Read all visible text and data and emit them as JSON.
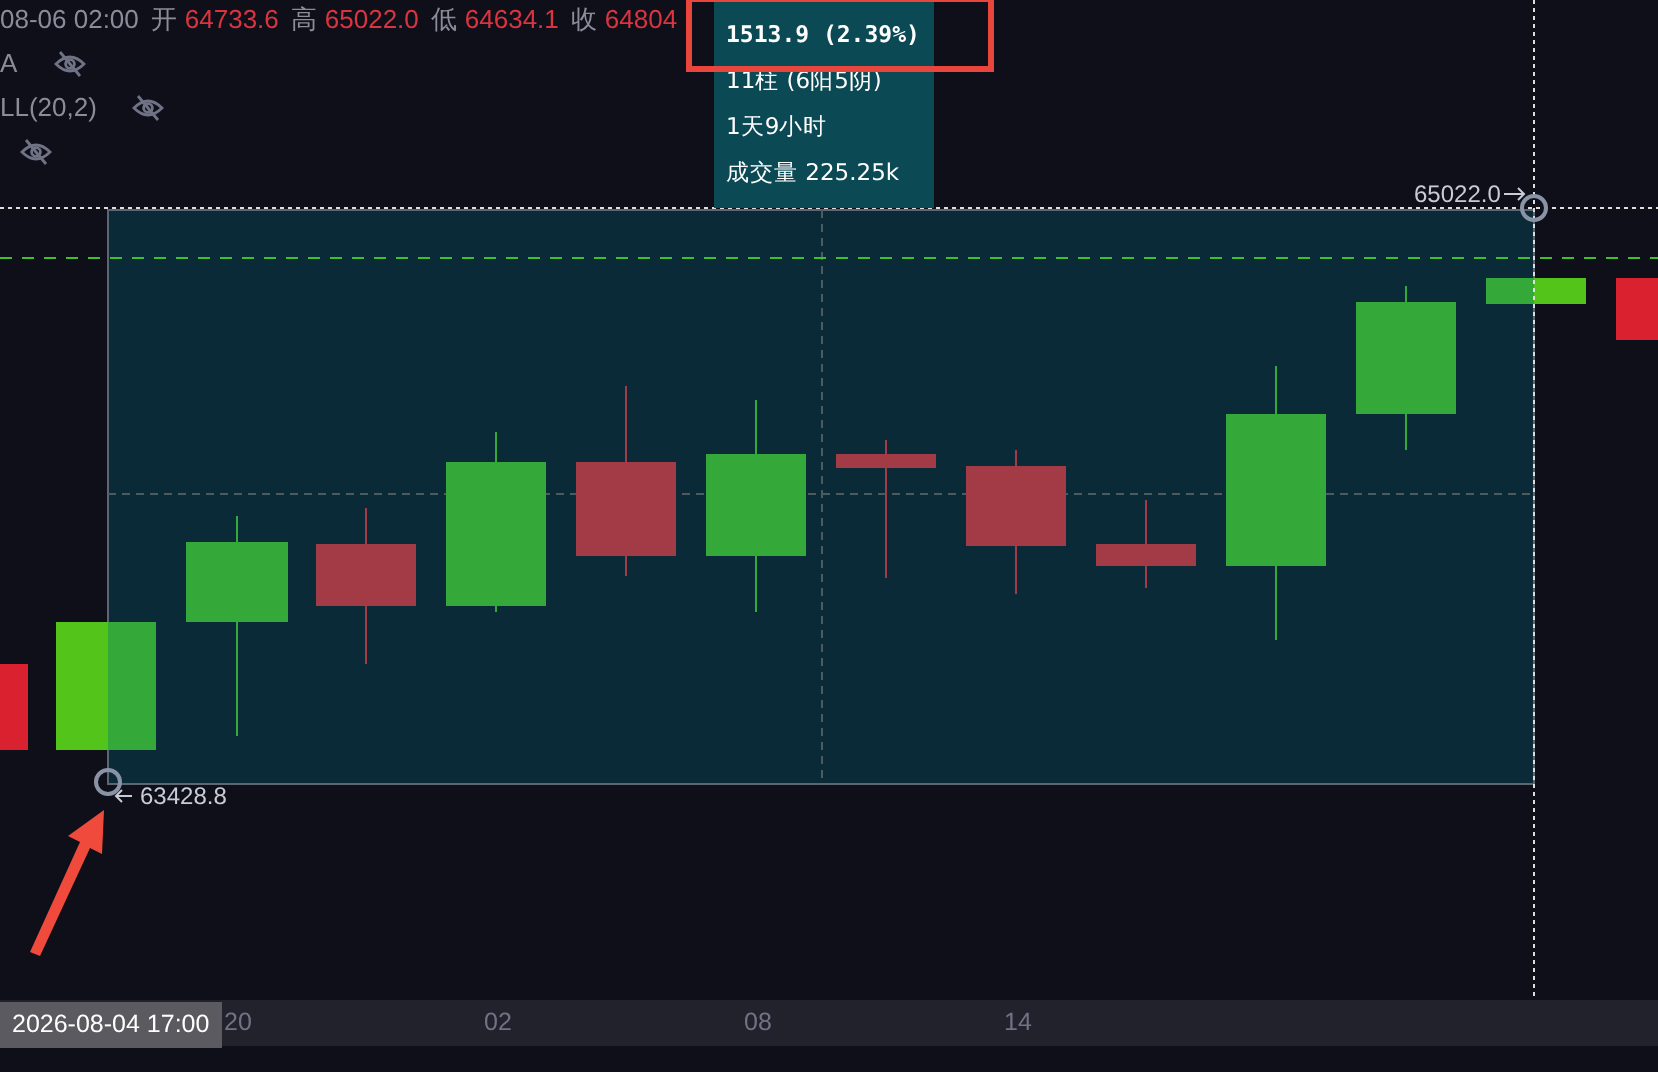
{
  "legend": {
    "time": "08-06 02:00",
    "fields": [
      {
        "label": "开",
        "value": "64733.6"
      },
      {
        "label": "高",
        "value": "65022.0"
      },
      {
        "label": "低",
        "value": "64634.1"
      },
      {
        "label": "收",
        "value": "64804"
      }
    ]
  },
  "indicators": [
    {
      "label": "A",
      "visible": false
    },
    {
      "label": "LL(20,2)",
      "visible": false
    },
    {
      "visible": false
    }
  ],
  "measure_tooltip": {
    "lines": [
      "1513.9 (2.39%)",
      "11柱 (6阳5阴)",
      "1天9小时",
      "成交量 225.25k"
    ],
    "highlighted": true
  },
  "price_labels": {
    "high": "65022.0",
    "low": "63428.8"
  },
  "time_axis": {
    "cursor_label": "2026-08-04 17:00",
    "ticks": [
      "20",
      "02",
      "08",
      "14"
    ]
  }
}
